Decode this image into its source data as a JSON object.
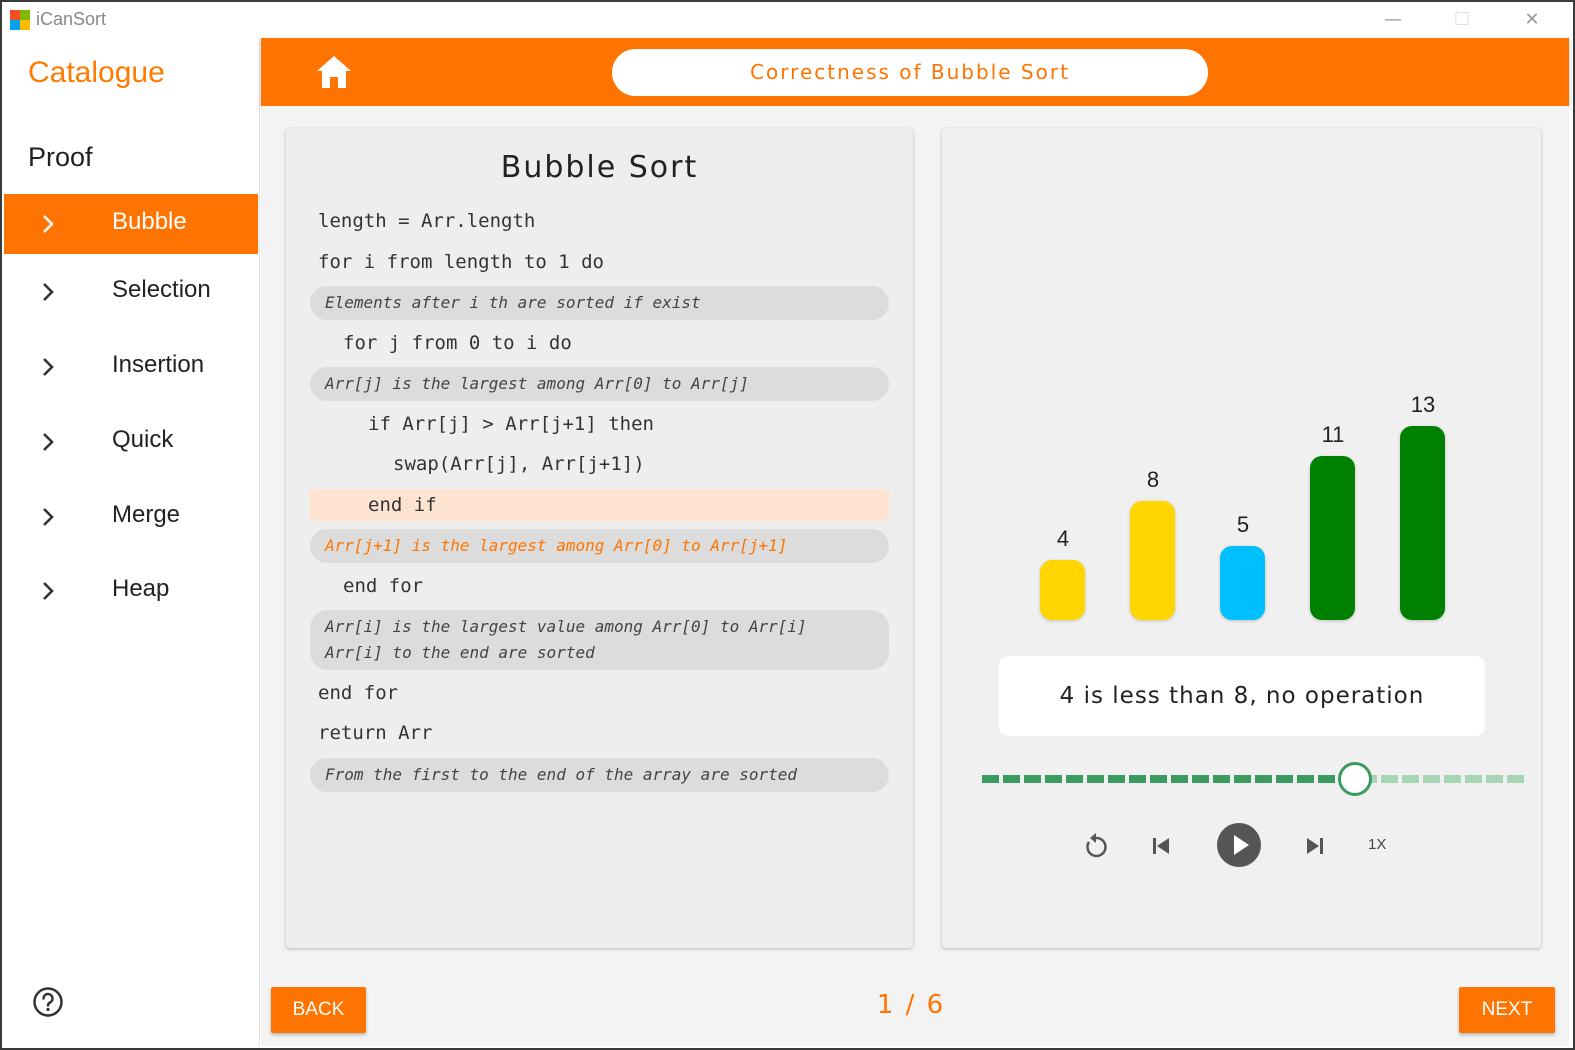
{
  "window": {
    "title": "iCanSort",
    "controls": {
      "minimize": "—",
      "maximize": "☐",
      "close": "✕"
    }
  },
  "sidebar": {
    "catalogue_label": "Catalogue",
    "section_title": "Proof",
    "items": [
      {
        "label": "Bubble",
        "active": true
      },
      {
        "label": "Selection",
        "active": false
      },
      {
        "label": "Insertion",
        "active": false
      },
      {
        "label": "Quick",
        "active": false
      },
      {
        "label": "Merge",
        "active": false
      },
      {
        "label": "Heap",
        "active": false
      }
    ]
  },
  "header": {
    "title": "Correctness of Bubble Sort"
  },
  "code": {
    "title": "Bubble Sort",
    "lines": [
      {
        "kind": "code",
        "text": "length = Arr.length",
        "indent": 0
      },
      {
        "kind": "code",
        "text": "for i from length to 1 do",
        "indent": 0
      },
      {
        "kind": "comment",
        "text": "Elements after i th are sorted if exist"
      },
      {
        "kind": "code",
        "text": "for j from 0 to i do",
        "indent": 1
      },
      {
        "kind": "comment",
        "text": "Arr[j] is the largest among Arr[0] to Arr[j]"
      },
      {
        "kind": "code",
        "text": "if Arr[j] > Arr[j+1] then",
        "indent": 2
      },
      {
        "kind": "code",
        "text": "swap(Arr[j], Arr[j+1])",
        "indent": 3
      },
      {
        "kind": "code",
        "text": "end if",
        "indent": 2,
        "highlight": true
      },
      {
        "kind": "comment",
        "text": "Arr[j+1] is the largest among Arr[0] to Arr[j+1]",
        "active": true
      },
      {
        "kind": "code",
        "text": "end for",
        "indent": 1
      },
      {
        "kind": "comment",
        "text": "Arr[i] is the largest value among Arr[0] to Arr[i]\nArr[i] to the end are sorted"
      },
      {
        "kind": "code",
        "text": "end for",
        "indent": 0
      },
      {
        "kind": "code",
        "text": "return Arr",
        "indent": 0
      },
      {
        "kind": "comment",
        "text": "From the first to the end of the array are sorted"
      }
    ]
  },
  "visualization": {
    "bars": [
      {
        "value": 4,
        "color": "#ffd600"
      },
      {
        "value": 8,
        "color": "#ffd600"
      },
      {
        "value": 5,
        "color": "#00bfff"
      },
      {
        "value": 11,
        "color": "#008000"
      },
      {
        "value": 13,
        "color": "#008000"
      }
    ],
    "message": "4 is less than 8, no operation",
    "progress": {
      "position": 0.69
    },
    "speed": "1X"
  },
  "footer": {
    "back_label": "BACK",
    "next_label": "NEXT",
    "page_indicator": "1 / 6"
  },
  "colors": {
    "accent": "#ff7400",
    "sorted": "#008000",
    "compare": "#ffd600",
    "unsorted": "#00bfff",
    "slider": "#3a9a60"
  }
}
